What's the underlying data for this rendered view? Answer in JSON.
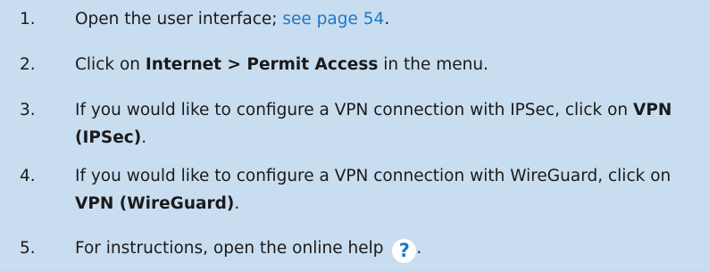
{
  "steps": [
    {
      "number": "1.",
      "text_before": "Open the user interface; ",
      "link": "see page 54",
      "text_after": "."
    },
    {
      "number": "2.",
      "text_before": "Click on ",
      "bold": "Internet > Permit Access",
      "text_after": " in the menu."
    },
    {
      "number": "3.",
      "text_before": "If you would like to configure a VPN connection with IPSec, click on ",
      "bold": "VPN (IPSec)",
      "text_after": "."
    },
    {
      "number": "4.",
      "text_before": "If you would like to configure a VPN connection with WireGuard, click on ",
      "bold": "VPN (WireGuard)",
      "text_after": "."
    },
    {
      "number": "5.",
      "text_before": "For instructions, open the online help ",
      "help_icon": "?",
      "text_after": "."
    }
  ],
  "colors": {
    "background": "#c9ddf0",
    "link": "#1e78c8",
    "help_icon_bg": "#ffffff"
  },
  "icons": {
    "help": "question-mark-circle-icon"
  }
}
